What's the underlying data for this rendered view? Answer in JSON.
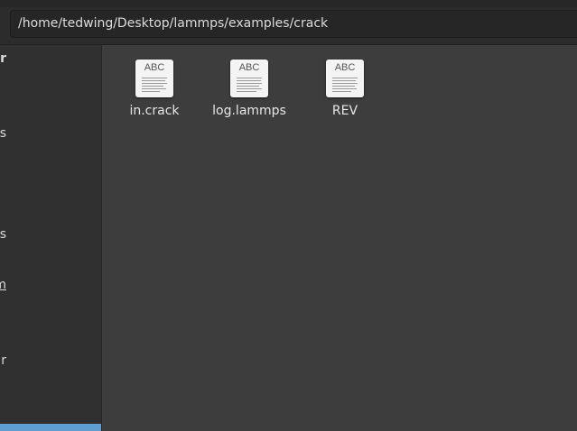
{
  "location": {
    "path": "/home/tedwing/Desktop/lammps/examples/crack"
  },
  "sidebar": {
    "items": [
      {
        "label": "r"
      },
      {
        "label": "ts"
      },
      {
        "label": "s"
      },
      {
        "label": "m"
      },
      {
        "label": "r"
      }
    ]
  },
  "files": [
    {
      "name": "in.crack",
      "icon": "text-file-icon",
      "thumb": "ABC"
    },
    {
      "name": "log.lammps",
      "icon": "text-file-icon",
      "thumb": "ABC"
    },
    {
      "name": "REV",
      "icon": "text-file-icon",
      "thumb": "ABC"
    }
  ],
  "colors": {
    "selection_accent": "#5e9ed2",
    "background": "#3d3d3d",
    "sidebar": "#303030"
  }
}
